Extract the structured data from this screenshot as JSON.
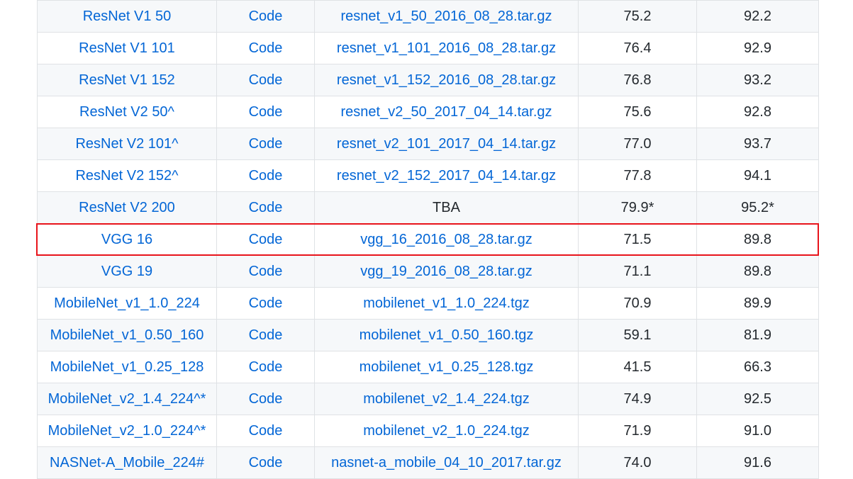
{
  "table": {
    "rows": [
      {
        "model": "ResNet V1 50",
        "code": "Code",
        "checkpoint": "resnet_v1_50_2016_08_28.tar.gz",
        "checkpoint_link": true,
        "top1": "75.2",
        "top5": "92.2"
      },
      {
        "model": "ResNet V1 101",
        "code": "Code",
        "checkpoint": "resnet_v1_101_2016_08_28.tar.gz",
        "checkpoint_link": true,
        "top1": "76.4",
        "top5": "92.9"
      },
      {
        "model": "ResNet V1 152",
        "code": "Code",
        "checkpoint": "resnet_v1_152_2016_08_28.tar.gz",
        "checkpoint_link": true,
        "top1": "76.8",
        "top5": "93.2"
      },
      {
        "model": "ResNet V2 50^",
        "code": "Code",
        "checkpoint": "resnet_v2_50_2017_04_14.tar.gz",
        "checkpoint_link": true,
        "top1": "75.6",
        "top5": "92.8"
      },
      {
        "model": "ResNet V2 101^",
        "code": "Code",
        "checkpoint": "resnet_v2_101_2017_04_14.tar.gz",
        "checkpoint_link": true,
        "top1": "77.0",
        "top5": "93.7"
      },
      {
        "model": "ResNet V2 152^",
        "code": "Code",
        "checkpoint": "resnet_v2_152_2017_04_14.tar.gz",
        "checkpoint_link": true,
        "top1": "77.8",
        "top5": "94.1"
      },
      {
        "model": "ResNet V2 200",
        "code": "Code",
        "checkpoint": "TBA",
        "checkpoint_link": false,
        "top1": "79.9*",
        "top5": "95.2*"
      },
      {
        "model": "VGG 16",
        "code": "Code",
        "checkpoint": "vgg_16_2016_08_28.tar.gz",
        "checkpoint_link": true,
        "top1": "71.5",
        "top5": "89.8"
      },
      {
        "model": "VGG 19",
        "code": "Code",
        "checkpoint": "vgg_19_2016_08_28.tar.gz",
        "checkpoint_link": true,
        "top1": "71.1",
        "top5": "89.8"
      },
      {
        "model": "MobileNet_v1_1.0_224",
        "code": "Code",
        "checkpoint": "mobilenet_v1_1.0_224.tgz",
        "checkpoint_link": true,
        "top1": "70.9",
        "top5": "89.9"
      },
      {
        "model": "MobileNet_v1_0.50_160",
        "code": "Code",
        "checkpoint": "mobilenet_v1_0.50_160.tgz",
        "checkpoint_link": true,
        "top1": "59.1",
        "top5": "81.9"
      },
      {
        "model": "MobileNet_v1_0.25_128",
        "code": "Code",
        "checkpoint": "mobilenet_v1_0.25_128.tgz",
        "checkpoint_link": true,
        "top1": "41.5",
        "top5": "66.3"
      },
      {
        "model": "MobileNet_v2_1.4_224^*",
        "code": "Code",
        "checkpoint": "mobilenet_v2_1.4_224.tgz",
        "checkpoint_link": true,
        "top1": "74.9",
        "top5": "92.5"
      },
      {
        "model": "MobileNet_v2_1.0_224^*",
        "code": "Code",
        "checkpoint": "mobilenet_v2_1.0_224.tgz",
        "checkpoint_link": true,
        "top1": "71.9",
        "top5": "91.0"
      },
      {
        "model": "NASNet-A_Mobile_224#",
        "code": "Code",
        "checkpoint": "nasnet-a_mobile_04_10_2017.tar.gz",
        "checkpoint_link": true,
        "top1": "74.0",
        "top5": "91.6"
      }
    ],
    "highlighted_row_index": 7
  },
  "colors": {
    "link": "#0366d6",
    "text": "#24292e",
    "border": "#dfe2e5",
    "stripe": "#f6f8fa",
    "highlight": "#e8141b"
  }
}
